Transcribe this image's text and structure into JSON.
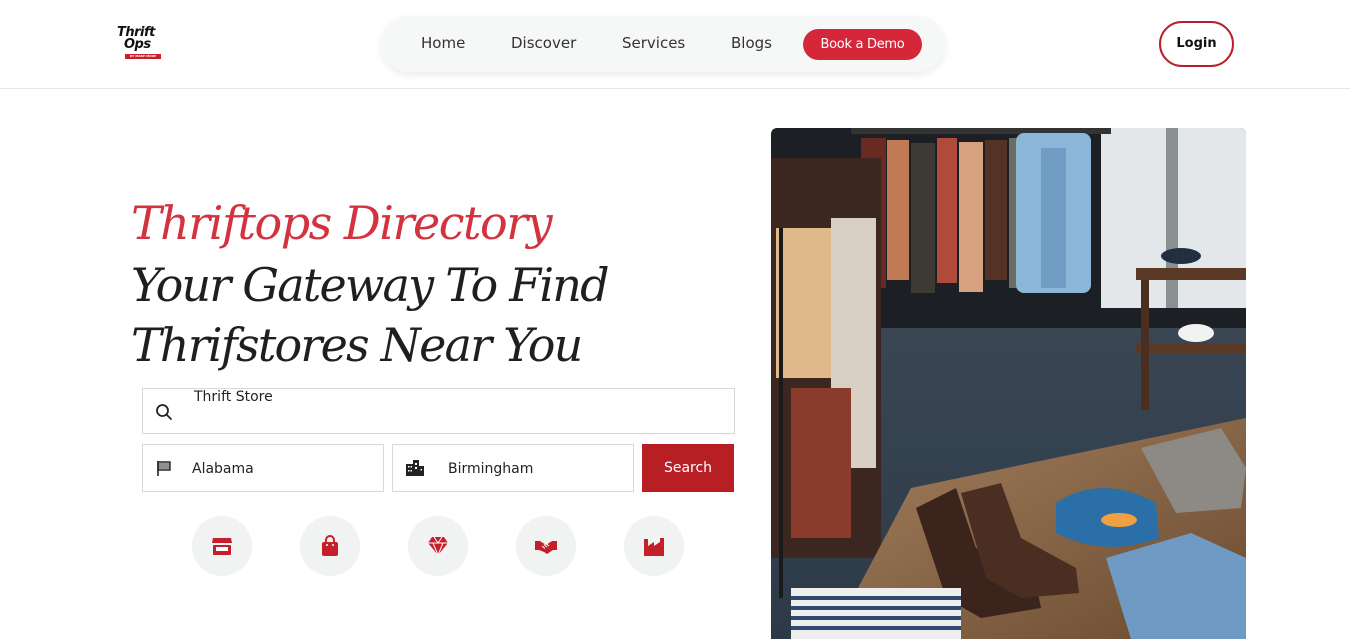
{
  "logo": {
    "line1": "Thrift",
    "line2": "Ops",
    "tagline": "BY MAKE MORE"
  },
  "nav": {
    "items": [
      "Home",
      "Discover",
      "Services",
      "Blogs"
    ],
    "demo_label": "Book a Demo"
  },
  "login_label": "Login",
  "hero": {
    "title": "Thriftops Directory",
    "subtitle_line1": "Your Gateway To Find",
    "subtitle_line2": "Thrifstores Near You"
  },
  "search": {
    "keyword": "Thrift Store",
    "state": "Alabama",
    "city": "Birmingham",
    "button_label": "Search"
  },
  "categories": [
    "store-icon",
    "shopping-bag-icon",
    "gem-icon",
    "handshake-icon",
    "factory-icon"
  ],
  "colors": {
    "accent": "#d4283a",
    "button": "#b81f24",
    "circle_bg": "#f1f3f2"
  }
}
